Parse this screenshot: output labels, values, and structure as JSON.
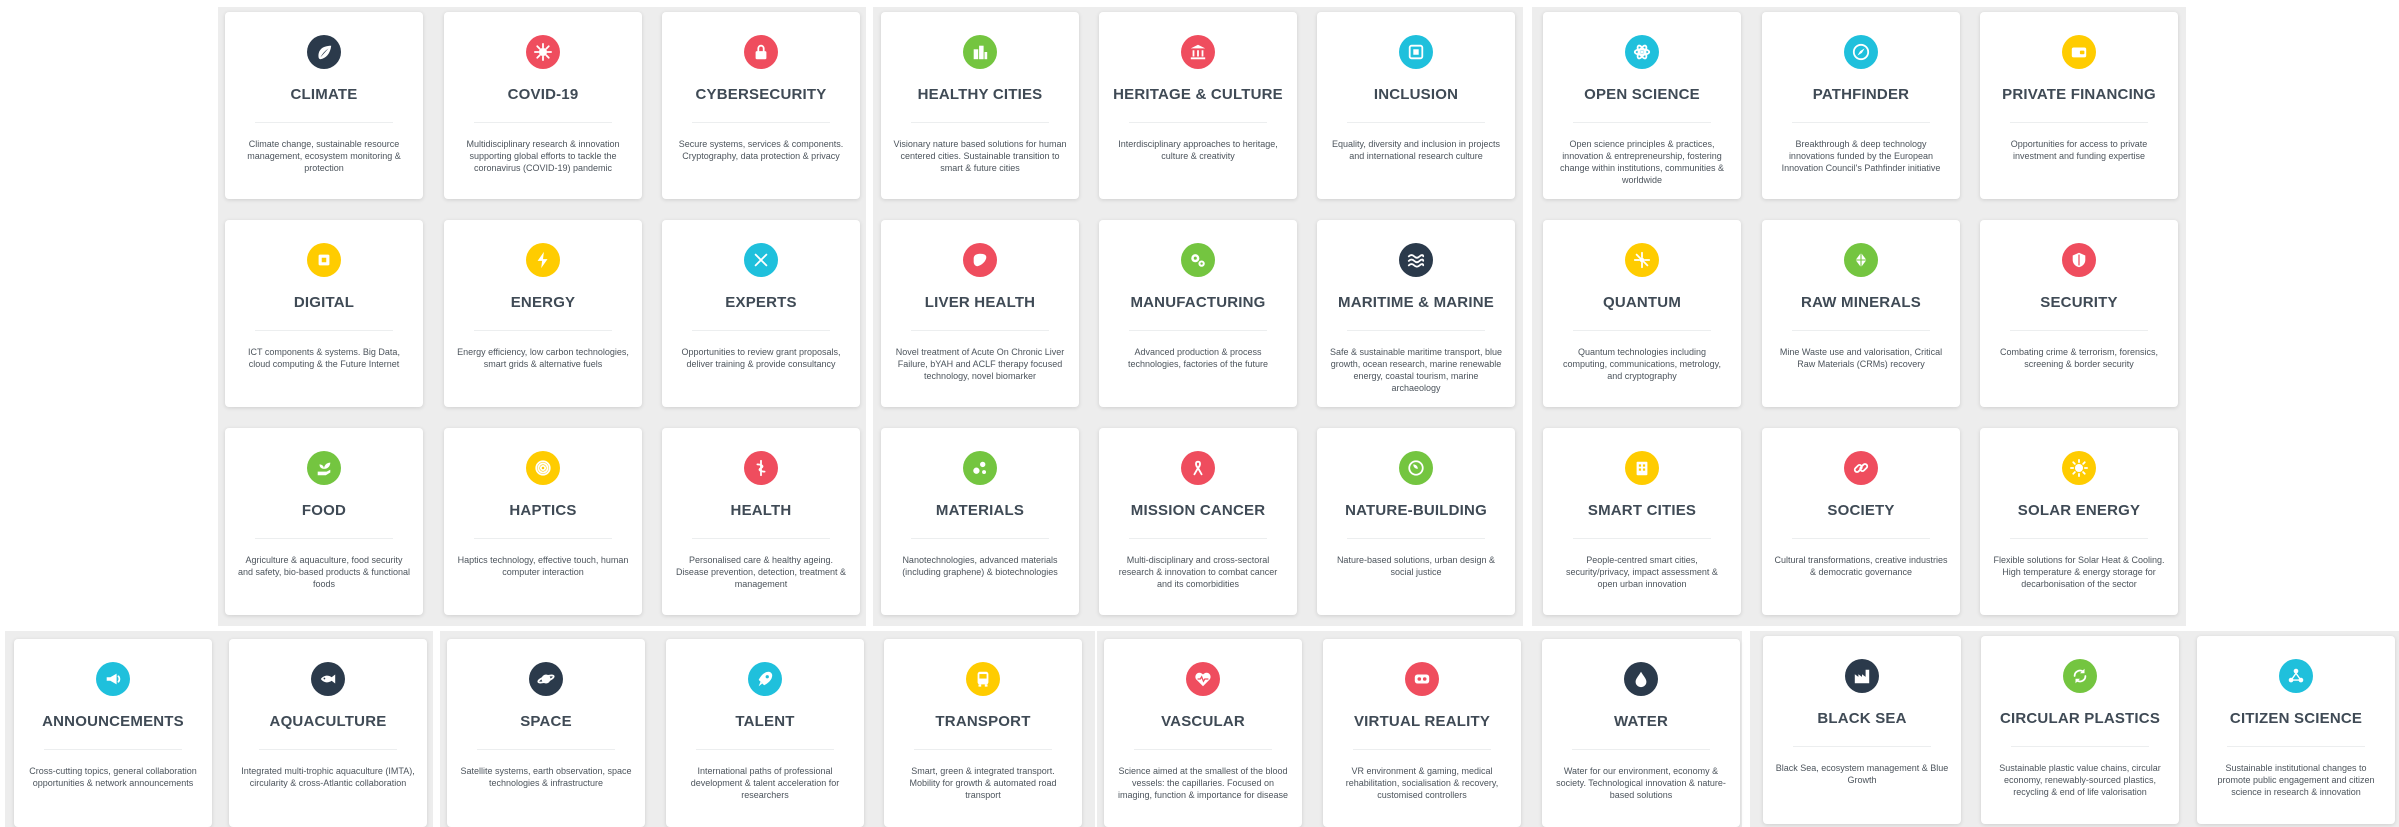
{
  "cards": [
    {
      "title": "CLIMATE",
      "desc": "Climate change, sustainable resource management, ecosystem monitoring & protection",
      "icon": "leaf-icon",
      "color": "#2b3a4b"
    },
    {
      "title": "COVID-19",
      "desc": "Multidisciplinary research & innovation supporting global efforts to tackle the coronavirus (COVID-19) pandemic",
      "icon": "virus-icon",
      "color": "#ef4d5e"
    },
    {
      "title": "CYBERSECURITY",
      "desc": "Secure systems, services & components. Cryptography, data protection & privacy",
      "icon": "lock-icon",
      "color": "#ef4d5e"
    },
    {
      "title": "HEALTHY CITIES",
      "desc": "Visionary nature based solutions for human centered cities. Sustainable transition to smart & future cities",
      "icon": "city-icon",
      "color": "#74c540"
    },
    {
      "title": "HERITAGE & CULTURE",
      "desc": "Interdisciplinary approaches to heritage, culture & creativity",
      "icon": "museum-icon",
      "color": "#ef4d5e"
    },
    {
      "title": "INCLUSION",
      "desc": "Equality, diversity and inclusion in projects and international research culture",
      "icon": "puzzle-icon",
      "color": "#1fc0dc"
    },
    {
      "title": "OPEN SCIENCE",
      "desc": "Open science principles & practices, innovation & entrepreneurship, fostering change within institutions, communities & worldwide",
      "icon": "atom-icon",
      "color": "#1fc0dc"
    },
    {
      "title": "PATHFINDER",
      "desc": "Breakthrough & deep technology innovations funded by the European Innovation Council's Pathfinder initiative",
      "icon": "compass-icon",
      "color": "#1fc0dc"
    },
    {
      "title": "PRIVATE FINANCING",
      "desc": "Opportunities for access to private investment and funding expertise",
      "icon": "wallet-icon",
      "color": "#ffcc00"
    },
    {
      "title": "DIGITAL",
      "desc": "ICT components & systems. Big Data, cloud computing & the Future Internet",
      "icon": "chip-icon",
      "color": "#ffcc00"
    },
    {
      "title": "ENERGY",
      "desc": "Energy efficiency, low carbon technologies, smart grids & alternative fuels",
      "icon": "lightning-icon",
      "color": "#ffcc00"
    },
    {
      "title": "EXPERTS",
      "desc": "Opportunities to review grant proposals, deliver training & provide consultancy",
      "icon": "tools-icon",
      "color": "#1fc0dc"
    },
    {
      "title": "LIVER HEALTH",
      "desc": "Novel treatment of Acute On Chronic Liver Failure, bYAH and ACLF therapy focused technology, novel biomarker",
      "icon": "liver-icon",
      "color": "#ef4d5e"
    },
    {
      "title": "MANUFACTURING",
      "desc": "Advanced production & process technologies, factories of the future",
      "icon": "gears-icon",
      "color": "#74c540"
    },
    {
      "title": "MARITIME & MARINE",
      "desc": "Safe & sustainable maritime transport, blue growth, ocean research, marine renewable energy, coastal tourism, marine archaeology",
      "icon": "waves-icon",
      "color": "#2b3a4b"
    },
    {
      "title": "QUANTUM",
      "desc": "Quantum technologies including computing, communications, metrology, and cryptography",
      "icon": "network-icon",
      "color": "#ffcc00"
    },
    {
      "title": "RAW MINERALS",
      "desc": "Mine Waste use and valorisation, Critical Raw Materials (CRMs) recovery",
      "icon": "crystal-icon",
      "color": "#74c540"
    },
    {
      "title": "SECURITY",
      "desc": "Combating crime & terrorism, forensics, screening & border security",
      "icon": "shield-icon",
      "color": "#ef4d5e"
    },
    {
      "title": "FOOD",
      "desc": "Agriculture & aquaculture, food security and safety, bio-based products & functional foods",
      "icon": "plant-hand-icon",
      "color": "#74c540"
    },
    {
      "title": "HAPTICS",
      "desc": "Haptics technology, effective touch, human computer interaction",
      "icon": "fingerprint-icon",
      "color": "#ffcc00"
    },
    {
      "title": "HEALTH",
      "desc": "Personalised care & healthy ageing. Disease prevention, detection, treatment & management",
      "icon": "caduceus-icon",
      "color": "#ef4d5e"
    },
    {
      "title": "MATERIALS",
      "desc": "Nanotechnologies, advanced materials (including graphene) & biotechnologies",
      "icon": "molecule-icon",
      "color": "#74c540"
    },
    {
      "title": "MISSION CANCER",
      "desc": "Multi-disciplinary and cross-sectoral research & innovation to combat cancer and its comorbidities",
      "icon": "ribbon-icon",
      "color": "#ef4d5e"
    },
    {
      "title": "NATURE-BUILDING",
      "desc": "Nature-based solutions, urban design & social justice",
      "icon": "globe-leaf-icon",
      "color": "#74c540"
    },
    {
      "title": "SMART CITIES",
      "desc": "People-centred smart cities, security/privacy, impact assessment & open urban innovation",
      "icon": "building-icon",
      "color": "#ffcc00"
    },
    {
      "title": "SOCIETY",
      "desc": "Cultural transformations, creative industries & democratic governance",
      "icon": "link-icon",
      "color": "#ef4d5e"
    },
    {
      "title": "SOLAR ENERGY",
      "desc": "Flexible solutions for Solar Heat & Cooling. High temperature & energy storage for decarbonisation of the sector",
      "icon": "sun-icon",
      "color": "#ffcc00"
    },
    {
      "title": "ANNOUNCEMENTS",
      "desc": "Cross-cutting topics, general collaboration opportunities & network announcements",
      "icon": "announce-icon",
      "color": "#1fc0dc"
    },
    {
      "title": "AQUACULTURE",
      "desc": "Integrated multi-trophic aquaculture (IMTA), circularity & cross-Atlantic collaboration",
      "icon": "fish-icon",
      "color": "#2b3a4b"
    },
    {
      "title": "SPACE",
      "desc": "Satellite systems, earth observation, space technologies & infrastructure",
      "icon": "planet-icon",
      "color": "#2b3a4b"
    },
    {
      "title": "TALENT",
      "desc": "International paths of professional development & talent acceleration for researchers",
      "icon": "rocket-icon",
      "color": "#1fc0dc"
    },
    {
      "title": "TRANSPORT",
      "desc": "Smart, green & integrated transport. Mobility for growth & automated road transport",
      "icon": "bus-icon",
      "color": "#ffcc00"
    },
    {
      "title": "VASCULAR",
      "desc": "Science aimed at the smallest of the blood vessels: the capillaries. Focused on imaging, function & importance for disease",
      "icon": "heart-pulse-icon",
      "color": "#ef4d5e"
    },
    {
      "title": "VIRTUAL REALITY",
      "desc": "VR environment & gaming, medical rehabilitation, socialisation & recovery, customised controllers",
      "icon": "vr-headset-icon",
      "color": "#ef4d5e"
    },
    {
      "title": "WATER",
      "desc": "Water for our environment, economy & society. Technological innovation & nature-based solutions",
      "icon": "droplet-icon",
      "color": "#2b3a4b"
    },
    {
      "title": "BLACK SEA",
      "desc": "Black Sea, ecosystem management & Blue Growth",
      "icon": "factory-icon",
      "color": "#2b3a4b"
    },
    {
      "title": "CIRCULAR PLASTICS",
      "desc": "Sustainable plastic value chains, circular economy, renewably-sourced plastics, recycling & end of life valorisation",
      "icon": "recycle-icon",
      "color": "#74c540"
    },
    {
      "title": "CITIZEN SCIENCE",
      "desc": "Sustainable institutional changes to promote public engagement and citizen science in research & innovation",
      "icon": "people-icon",
      "color": "#1fc0dc"
    }
  ]
}
